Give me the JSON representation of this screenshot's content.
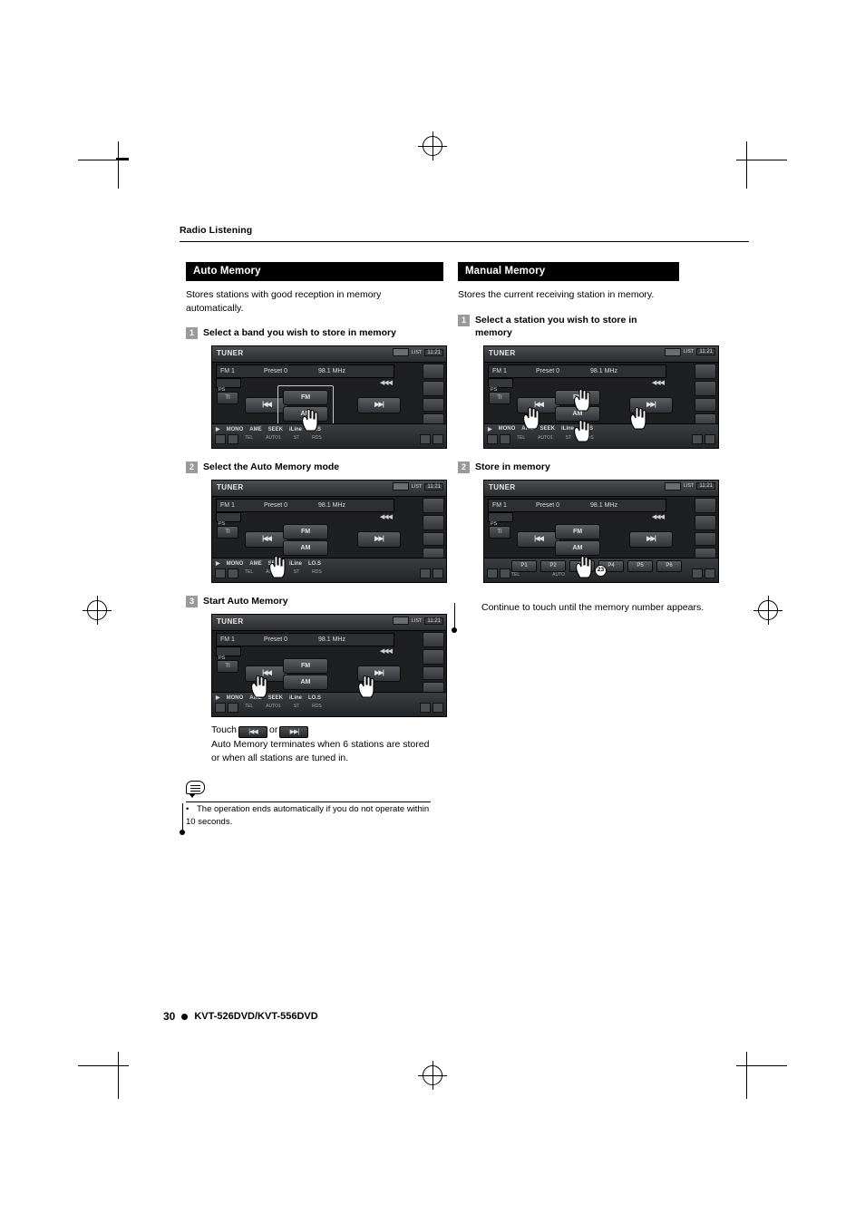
{
  "page": {
    "running_head": "Radio Listening",
    "number": "30",
    "model": "KVT-526DVD/KVT-556DVD"
  },
  "left_column": {
    "title": "Auto Memory",
    "intro": "Stores stations with good reception in memory automatically.",
    "steps": [
      {
        "num": "1",
        "text": "Select a band you wish to store in memory"
      },
      {
        "num": "2",
        "text": "Select the Auto Memory mode"
      },
      {
        "num": "3",
        "text": "Start Auto Memory"
      }
    ],
    "touch_note_prefix": "Touch",
    "touch_note_or": "or",
    "touch_note_key_left": "|◀◀",
    "touch_note_key_right": "▶▶|",
    "touch_note_body": "Auto Memory terminates when 6 stations are stored or when all stations are tuned in.",
    "memo_bullet": "•",
    "memo_text": "The operation ends automatically if you do not operate within 10 seconds."
  },
  "right_column": {
    "title": "Manual Memory",
    "intro": "Stores the current receiving station in memory.",
    "steps": [
      {
        "num": "1",
        "text": "Select a station you wish to store in memory"
      },
      {
        "num": "2",
        "text": "Store in memory"
      }
    ],
    "note": "Continue to touch until the memory number appears.",
    "callout_number": "23"
  },
  "screen": {
    "title": "TUNER",
    "clock": "11:21",
    "list_label": "LIST",
    "band": "FM  1",
    "preset": "Preset  0",
    "frequency": "98.1 MHz",
    "ps_label": "PS",
    "ti_label": "TI",
    "fm_label": "FM",
    "am_label": "AM",
    "prev_label": "|◀◀",
    "next_label": "▶▶|",
    "seek_indicator": "◀◀◀",
    "bottom_labels": [
      "MONO",
      "AME",
      "SEEK",
      "iLine",
      "LO.S"
    ],
    "bottom_sub_labels": [
      "AUTO1",
      "ST",
      "RDS"
    ],
    "tel_label": "TEL",
    "play_icon": "▶",
    "presets": [
      "P1",
      "P2",
      "P3",
      "P4",
      "P5",
      "P6"
    ],
    "auto_sub": "AUTO"
  }
}
